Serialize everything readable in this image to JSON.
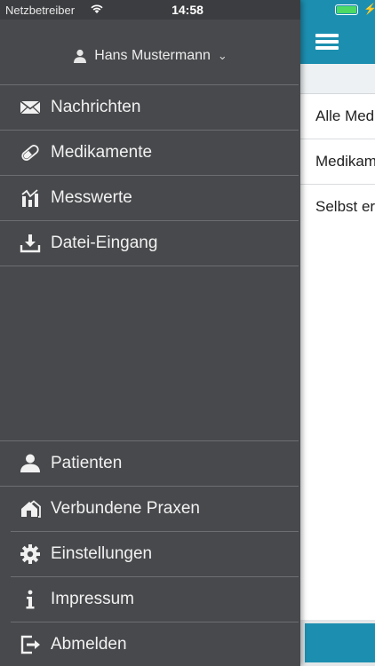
{
  "statusbar": {
    "carrier": "Netzbetreiber",
    "time": "14:58",
    "battery_color": "#4cd964"
  },
  "colors": {
    "drawer_bg": "#48494c",
    "header_accent": "#1c8fb0"
  },
  "drawer": {
    "user_name": "Hans Mustermann",
    "top_items": [
      {
        "label": "Nachrichten",
        "icon": "envelope-icon"
      },
      {
        "label": "Medikamente",
        "icon": "pill-icon"
      },
      {
        "label": "Messwerte",
        "icon": "chart-icon"
      },
      {
        "label": "Datei-Eingang",
        "icon": "download-icon"
      }
    ],
    "bottom_items": [
      {
        "label": "Patienten",
        "icon": "person-icon"
      },
      {
        "label": "Verbundene Praxen",
        "icon": "house-icon"
      },
      {
        "label": "Einstellungen",
        "icon": "gear-icon"
      },
      {
        "label": "Impressum",
        "icon": "info-icon"
      },
      {
        "label": "Abmelden",
        "icon": "logout-icon"
      }
    ]
  },
  "main": {
    "list_items": [
      "Alle Medikamente",
      "Medikamente",
      "Selbst erfasst"
    ]
  }
}
